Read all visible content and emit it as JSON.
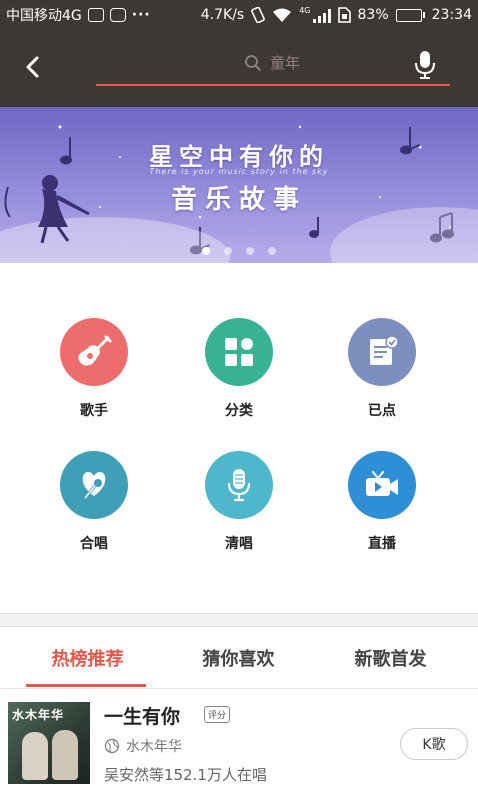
{
  "status_bar": {
    "carrier": "中国移动4G",
    "speed": "4.7K/s",
    "network": "4G",
    "battery_text": "83%",
    "battery_level": 0.83,
    "time": "23:34",
    "dots": "···"
  },
  "header": {
    "search_placeholder": "童年",
    "back_icon": "chevron-left-icon",
    "mic_icon": "microphone-icon",
    "accent_color": "#e5574b"
  },
  "banner": {
    "line1": "星空中有你的",
    "subtitle": "There is your music story in the sky",
    "line2": "音乐故事",
    "page_count": 4,
    "active_page": 1
  },
  "grid": {
    "items": [
      {
        "label": "歌手",
        "icon": "guitar-icon",
        "color": "#ec6d6b"
      },
      {
        "label": "分类",
        "icon": "category-grid-icon",
        "color": "#37b394"
      },
      {
        "label": "已点",
        "icon": "checklist-icon",
        "color": "#7d8fbf"
      },
      {
        "label": "合唱",
        "icon": "duet-mic-icon",
        "color": "#3f9fb6"
      },
      {
        "label": "清唱",
        "icon": "microphone-icon",
        "color": "#4eb7cb"
      },
      {
        "label": "直播",
        "icon": "video-camera-icon",
        "color": "#2f8fd6"
      }
    ]
  },
  "tabs": [
    {
      "label": "热榜推荐",
      "active": true
    },
    {
      "label": "猜你喜欢",
      "active": false
    },
    {
      "label": "新歌首发",
      "active": false
    }
  ],
  "song": {
    "cover_text": "水木年华",
    "title": "一生有你",
    "tag": "评分",
    "artist": "水木年华",
    "singing": "吴安然等152.1万人在唱",
    "button": "K歌"
  }
}
